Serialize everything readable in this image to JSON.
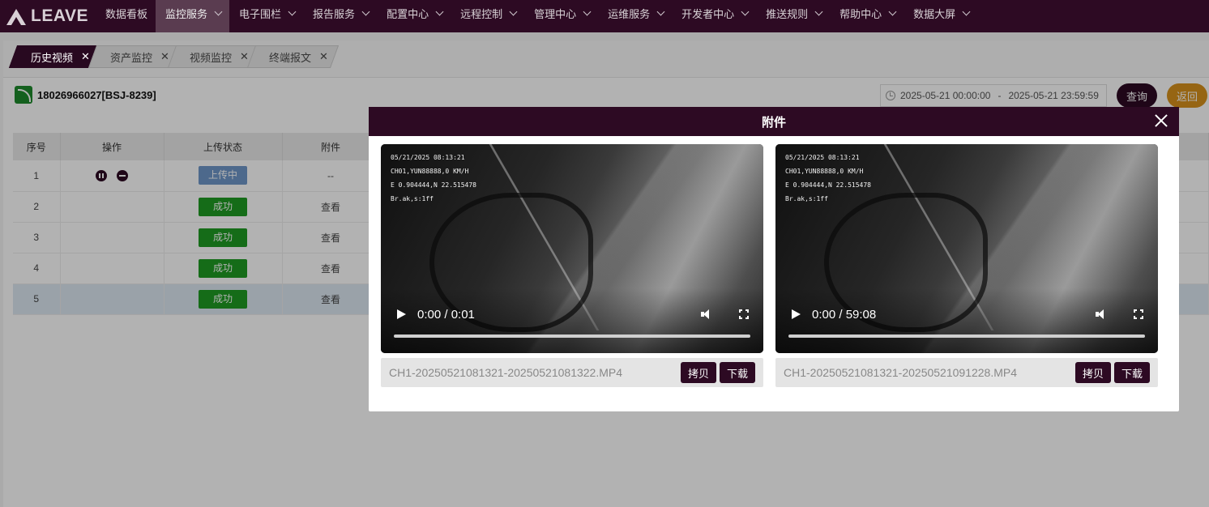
{
  "nav": {
    "logo": "LEAVE",
    "items": [
      {
        "label": "数据看板",
        "dropdown": false
      },
      {
        "label": "监控服务",
        "dropdown": true,
        "active": true
      },
      {
        "label": "电子围栏",
        "dropdown": true
      },
      {
        "label": "报告服务",
        "dropdown": true
      },
      {
        "label": "配置中心",
        "dropdown": true
      },
      {
        "label": "远程控制",
        "dropdown": true
      },
      {
        "label": "管理中心",
        "dropdown": true
      },
      {
        "label": "运维服务",
        "dropdown": true
      },
      {
        "label": "开发者中心",
        "dropdown": true
      },
      {
        "label": "推送规则",
        "dropdown": true
      },
      {
        "label": "帮助中心",
        "dropdown": true
      },
      {
        "label": "数据大屏",
        "dropdown": true
      }
    ]
  },
  "tabs": [
    {
      "label": "历史视频",
      "active": true
    },
    {
      "label": "资产监控"
    },
    {
      "label": "视频监控"
    },
    {
      "label": "终端报文"
    }
  ],
  "device": {
    "title": "18026966027[BSJ-8239]"
  },
  "filter": {
    "start": "2025-05-21 00:00:00",
    "separator": "-",
    "end": "2025-05-21 23:59:59",
    "query_label": "查询",
    "back_label": "返回"
  },
  "table": {
    "columns": [
      "序号",
      "操作",
      "上传状态",
      "附件"
    ],
    "rows": [
      {
        "index": "1",
        "status": "上传中",
        "status_kind": "uploading",
        "attachment": "--",
        "ops": [
          "pause-icon",
          "stop-icon"
        ]
      },
      {
        "index": "2",
        "status": "成功",
        "status_kind": "success",
        "attachment": "查看"
      },
      {
        "index": "3",
        "status": "成功",
        "status_kind": "success",
        "attachment": "查看"
      },
      {
        "index": "4",
        "status": "成功",
        "status_kind": "success",
        "attachment": "查看"
      },
      {
        "index": "5",
        "status": "成功",
        "status_kind": "success",
        "attachment": "查看",
        "selected": true
      }
    ]
  },
  "modal": {
    "title": "附件",
    "attachments": [
      {
        "osd": [
          "05/21/2025 08:13:21",
          "CH01,YUN88888,0 KM/H",
          "E 0.904444,N 22.515478",
          "Br.ak,s:1ff"
        ],
        "time": "0:00 / 0:01",
        "filename": "CH1-20250521081321-20250521081322.MP4",
        "copy_label": "拷贝",
        "download_label": "下载"
      },
      {
        "osd": [
          "05/21/2025 08:13:21",
          "CH01,YUN88888,0 KM/H",
          "E 0.904444,N 22.515478",
          "Br.ak,s:1ff"
        ],
        "time": "0:00 / 59:08",
        "filename": "CH1-20250521081321-20250521091228.MP4",
        "copy_label": "拷贝",
        "download_label": "下载"
      }
    ]
  },
  "colors": {
    "brand": "#2d0a23",
    "success": "#1f9b23",
    "uploading": "#6f97c9",
    "back": "#d7911c"
  }
}
